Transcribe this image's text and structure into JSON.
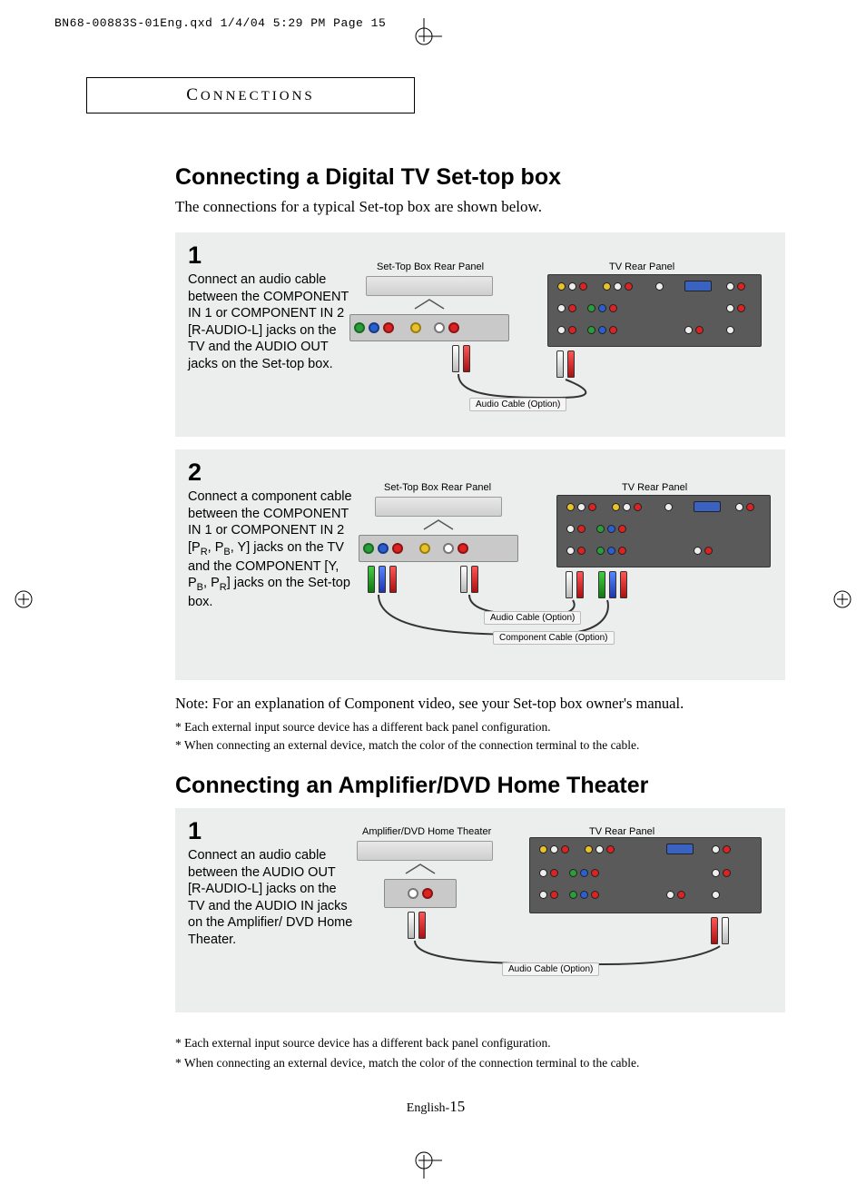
{
  "print_header": "BN68-00883S-01Eng.qxd  1/4/04 5:29 PM  Page 15",
  "section_label": "Connections",
  "heading1": "Connecting a Digital TV Set-top box",
  "intro1": "The connections for a typical Set-top box are shown below.",
  "step1": {
    "num": "1",
    "text": "Connect an audio cable between the COMPONENT IN 1 or COMPONENT IN 2 [R-AUDIO-L] jacks on the TV and the AUDIO OUT jacks on the Set-top box.",
    "label_setbox": "Set-Top Box Rear Panel",
    "label_tv": "TV Rear Panel",
    "cable_audio": "Audio Cable (Option)"
  },
  "step2": {
    "num": "2",
    "text_prefix": "Connect a component cable between the COMPONENT IN 1 or COMPONENT IN 2 [P",
    "text_mid1": ", P",
    "text_mid2": ", Y] jacks on the TV and the COMPONENT [Y, P",
    "text_mid3": ", P",
    "text_suffix": "] jacks on the Set-top box.",
    "sub_r": "R",
    "sub_b": "B",
    "label_setbox": "Set-Top Box Rear Panel",
    "label_tv": "TV Rear Panel",
    "cable_audio": "Audio Cable (Option)",
    "cable_component": "Component Cable (Option)"
  },
  "note1": "Note: For an explanation of Component video, see your Set-top box owner's manual.",
  "ast1": "*  Each external input source device has a different back panel configuration.",
  "ast2": "*  When connecting an external device, match the color of the connection terminal to the cable.",
  "heading2": "Connecting an Amplifier/DVD Home Theater",
  "step3": {
    "num": "1",
    "text": "Connect an audio cable between the AUDIO OUT [R-AUDIO-L] jacks on the TV and the AUDIO IN jacks on the Amplifier/ DVD Home Theater.",
    "label_amp": "Amplifier/DVD Home Theater",
    "label_tv": "TV Rear Panel",
    "cable_audio": "Audio Cable (Option)"
  },
  "ast3": "*  Each external input source device has a different back panel configuration.",
  "ast4": "*  When connecting an external device, match the color of the connection terminal to the cable.",
  "footer_lang": "English-",
  "footer_page": "15"
}
